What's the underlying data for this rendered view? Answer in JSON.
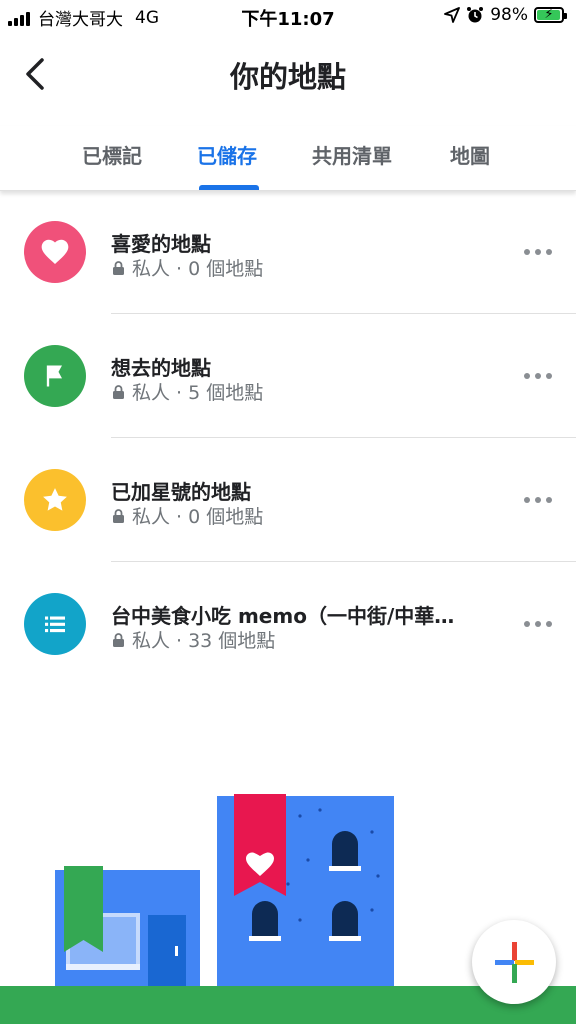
{
  "status_bar": {
    "carrier": "台灣大哥大",
    "network": "4G",
    "time": "下午11:07",
    "battery": "98%"
  },
  "header": {
    "title": "你的地點"
  },
  "tabs": [
    {
      "label": "已標記"
    },
    {
      "label": "已儲存"
    },
    {
      "label": "共用清單"
    },
    {
      "label": "地圖"
    }
  ],
  "active_tab": "已儲存",
  "lists": [
    {
      "name": "喜愛的地點",
      "privacy": "私人",
      "count": "· 0 個地點",
      "icon": "heart-icon",
      "color": "#f0517a"
    },
    {
      "name": "想去的地點",
      "privacy": "私人",
      "count": "· 5 個地點",
      "icon": "flag-icon",
      "color": "#34a853"
    },
    {
      "name": "已加星號的地點",
      "privacy": "私人",
      "count": "· 0 個地點",
      "icon": "star-icon",
      "color": "#fbc02d"
    },
    {
      "name": "台中美食小吃 memo（一中街/中華…",
      "privacy": "私人",
      "count": "· 33 個地點",
      "icon": "list-icon",
      "color": "#12a4c9"
    }
  ],
  "colors": {
    "accent": "#1a73e8",
    "building_blue": "#4285f4",
    "ribbon_red": "#e8174f",
    "ground_green": "#34a853"
  }
}
